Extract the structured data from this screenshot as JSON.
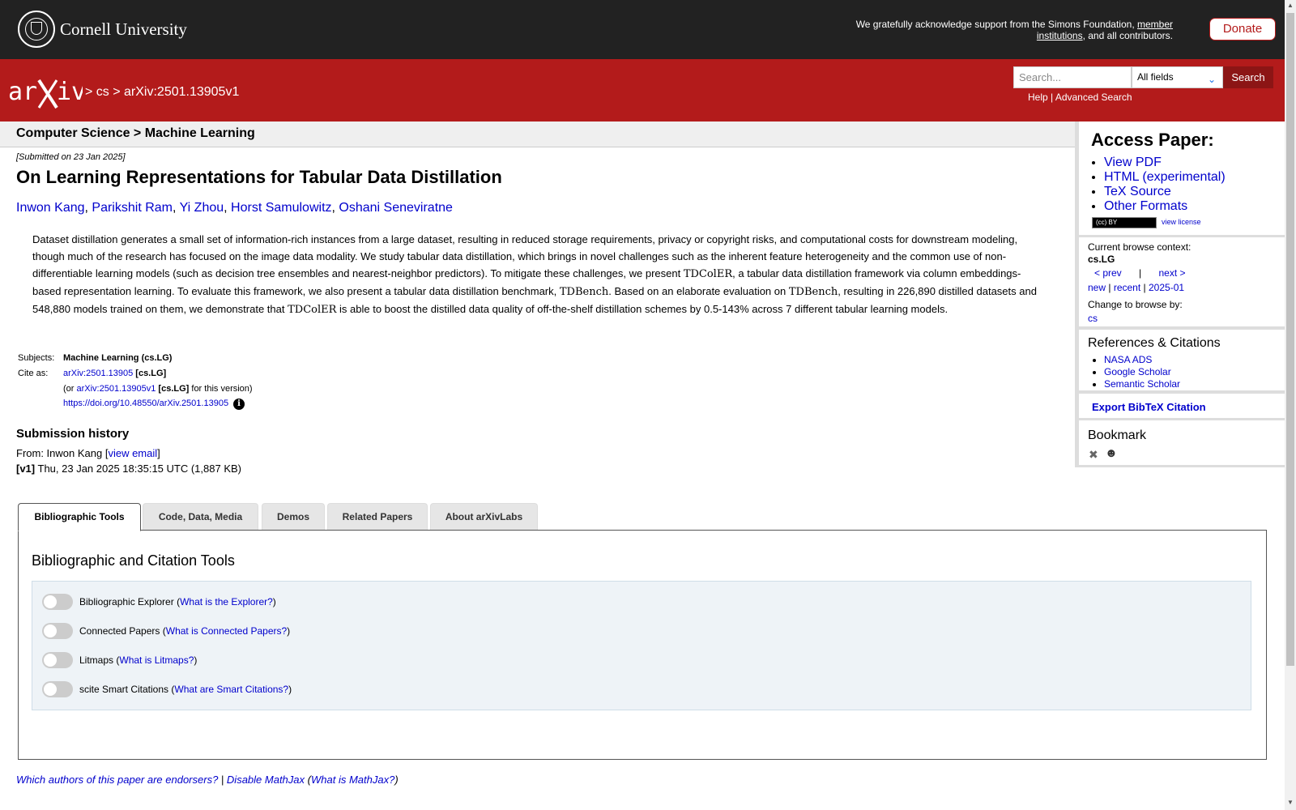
{
  "top": {
    "university": "Cornell University",
    "support_before": "We gratefully acknowledge support from the Simons Foundation, ",
    "support_link": "member institutions",
    "support_after": ", and all contributors.",
    "donate": "Donate"
  },
  "header": {
    "breadcrumb": "> cs > arXiv:2501.13905v1",
    "search_placeholder": "Search...",
    "search_field": "All fields",
    "search_button": "Search",
    "help": "Help",
    "sep": "|",
    "advanced": "Advanced Search"
  },
  "subheader": "Computer Science > Machine Learning",
  "paper": {
    "submitted": "[Submitted on 23 Jan 2025]",
    "title": "On Learning Representations for Tabular Data Distillation",
    "authors": [
      "Inwon Kang",
      "Parikshit Ram",
      "Yi Zhou",
      "Horst Samulowitz",
      "Oshani Seneviratne"
    ],
    "abstract": {
      "p1": "Dataset distillation generates a small set of information-rich instances from a large dataset, resulting in reduced storage requirements, privacy or copyright risks, and computational costs for downstream modeling, though much of the research has focused on the image data modality. We study tabular data distillation, which brings in novel challenges such as the inherent feature heterogeneity and the common use of non-differentiable learning models (such as decision tree ensembles and nearest-neighbor predictors). To mitigate these challenges, we present ",
      "m1": "TDColER",
      "p2": ", a tabular data distillation framework via column embeddings-based representation learning. To evaluate this framework, we also present a tabular data distillation benchmark, ",
      "m2": "TDBench",
      "p3": ". Based on an elaborate evaluation on ",
      "m3": "TDBench",
      "p4": ", resulting in 226,890 distilled datasets and 548,880 models trained on them, we demonstrate that ",
      "m4": "TDColER",
      "p5": " is able to boost the distilled data quality of off-the-shelf distillation schemes by 0.5-143% across 7 different tabular learning models."
    },
    "subjects_label": "Subjects:",
    "subjects_value": "Machine Learning (cs.LG)",
    "cite_label": "Cite as:",
    "cite_id": "arXiv:2501.13905",
    "cite_cat": "[cs.LG]",
    "version_pre": "(or ",
    "version_id": "arXiv:2501.13905v1",
    "version_cat": "[cs.LG]",
    "version_post": " for this version)",
    "doi": "https://doi.org/10.48550/arXiv.2501.13905",
    "info_glyph": "i",
    "history_title": "Submission history",
    "from_label": "From: Inwon Kang [",
    "view_email": "view email",
    "from_close": "]",
    "v1_label": "[v1]",
    "v1_text": " Thu, 23 Jan 2025 18:35:15 UTC (1,887 KB)"
  },
  "access": {
    "title": "Access Paper:",
    "links": [
      "View PDF",
      "HTML (experimental)",
      "TeX Source",
      "Other Formats"
    ],
    "cc_label": "(cc) BY",
    "view_license": "view license"
  },
  "browse": {
    "context_label": "Current browse context:",
    "context": "cs.LG",
    "prev": "< prev",
    "sep": "|",
    "next": "next >",
    "new": "new",
    "recent": "recent",
    "month": "2025-01",
    "change_label": "Change to browse by:",
    "cs": "cs"
  },
  "refs": {
    "title": "References & Citations",
    "links": [
      "NASA ADS",
      "Google Scholar",
      "Semantic Scholar"
    ]
  },
  "export": "Export BibTeX Citation",
  "bookmark": "Bookmark",
  "tabs": [
    "Bibliographic Tools",
    "Code, Data, Media",
    "Demos",
    "Related Papers",
    "About arXivLabs"
  ],
  "panel": {
    "title": "Bibliographic and Citation Tools",
    "tools": [
      {
        "name": "Bibliographic Explorer",
        "link": "What is the Explorer?"
      },
      {
        "name": "Connected Papers",
        "link": "What is Connected Papers?"
      },
      {
        "name": "Litmaps",
        "link": "What is Litmaps?"
      },
      {
        "name": "scite Smart Citations",
        "link": "What are Smart Citations?"
      }
    ]
  },
  "footer": {
    "endorsers": "Which authors of this paper are endorsers?",
    "sep": " | ",
    "disable": "Disable MathJax",
    "what_open": " (",
    "what": "What is MathJax?",
    "what_close": ")"
  },
  "colors": {
    "topbar": "#222222",
    "brand_red": "#b31b1b",
    "link": "#0000cc"
  }
}
